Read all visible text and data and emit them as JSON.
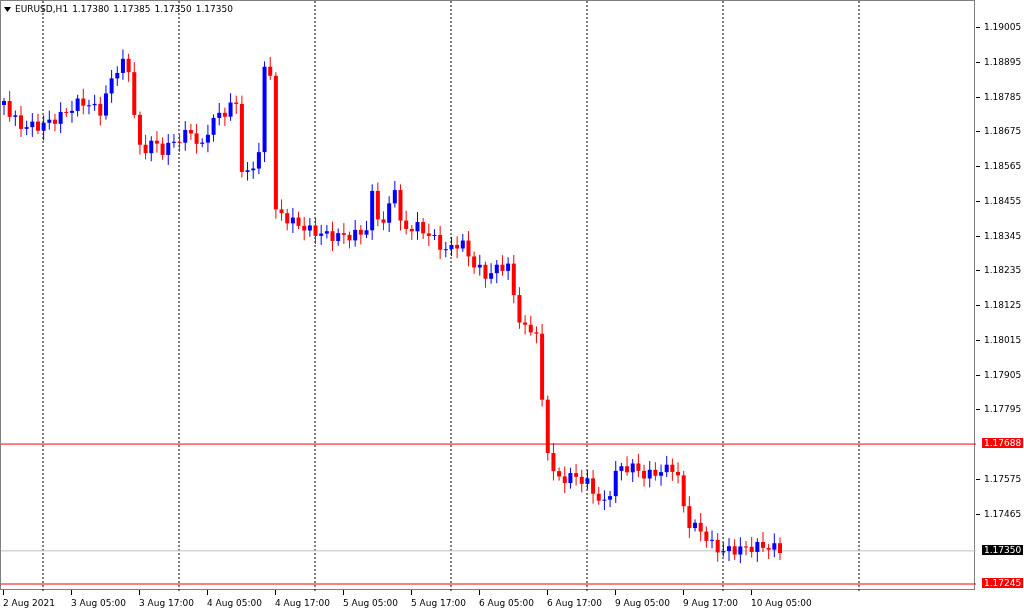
{
  "chart": {
    "symbol": "EURUSD,H1",
    "quotes": [
      "1.17380",
      "1.17385",
      "1.17350",
      "1.17350"
    ],
    "price_axis": [
      "1.19005",
      "1.18895",
      "1.18785",
      "1.18675",
      "1.18565",
      "1.18455",
      "1.18345",
      "1.18235",
      "1.18125",
      "1.18015",
      "1.17905",
      "1.17795",
      "1.17575",
      "1.17465"
    ],
    "levels": [
      {
        "price": "1.17688",
        "color": "#ff0000"
      },
      {
        "price": "1.17350",
        "color": "#000000"
      },
      {
        "price": "1.17245",
        "color": "#ff0000"
      }
    ],
    "time_axis": [
      "2 Aug 2021",
      "3 Aug 05:00",
      "3 Aug 17:00",
      "4 Aug 05:00",
      "4 Aug 17:00",
      "5 Aug 05:00",
      "5 Aug 17:00",
      "6 Aug 05:00",
      "6 Aug 17:00",
      "9 Aug 05:00",
      "9 Aug 17:00",
      "10 Aug 05:00"
    ]
  }
}
